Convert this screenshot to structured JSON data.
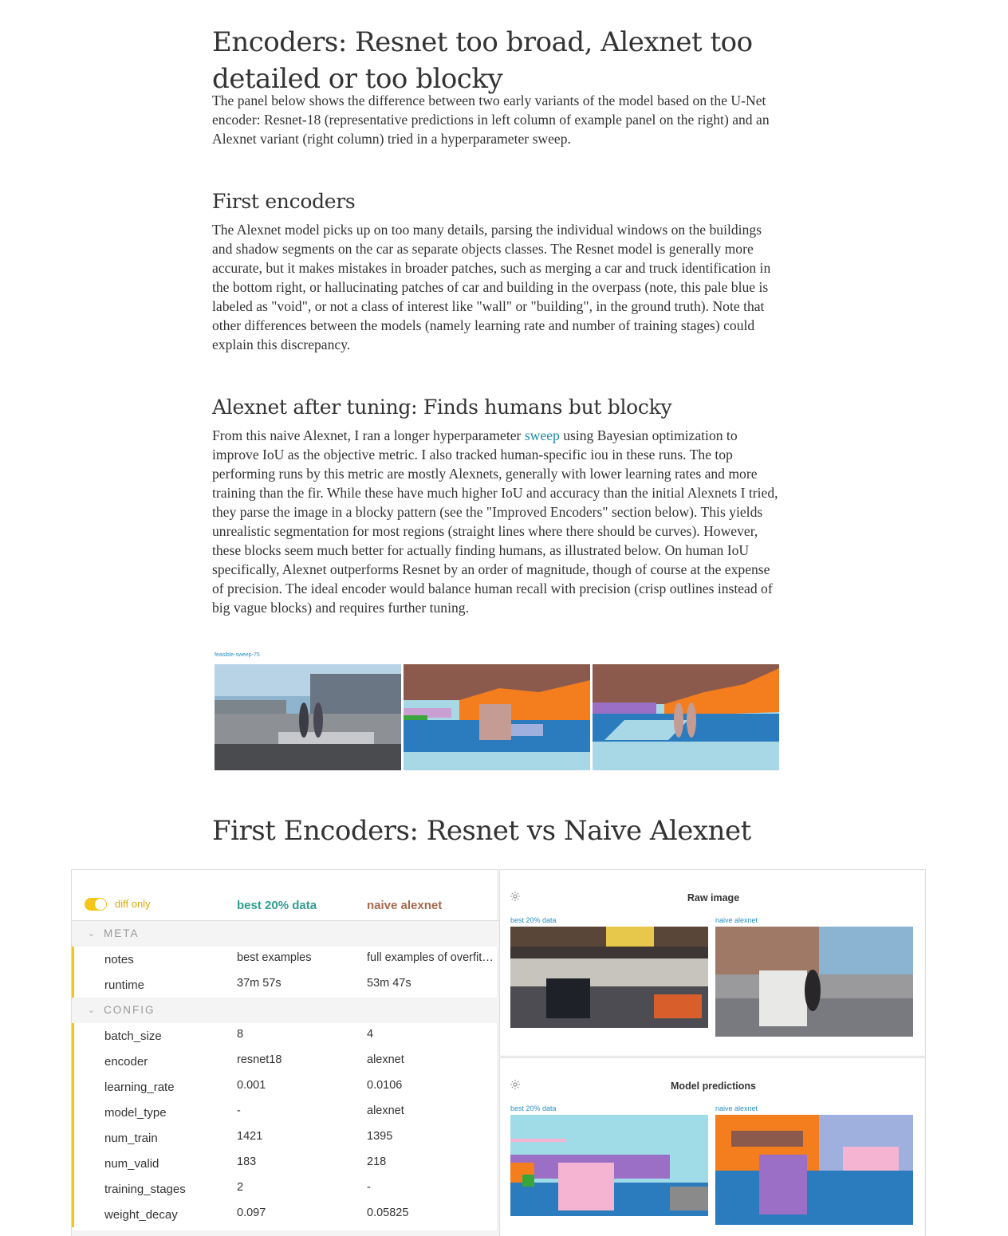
{
  "article": {
    "h1_encoders": "Encoders: Resnet too broad, Alexnet too detailed or too blocky",
    "p1": "The panel below shows the difference between two early variants of the model based on the U-Net encoder: Resnet-18 (representative predictions in left column of example panel on the right) and an Alexnet variant (right column) tried in a hyperparameter sweep.",
    "h2_first": "First encoders",
    "p2": "The Alexnet model picks up on too many details, parsing the individual windows on the buildings and shadow segments on the car as separate objects classes. The Resnet model is generally more accurate, but it makes mistakes in broader patches, such as merging a car and truck identification in the bottom right, or hallucinating patches of car and building in the overpass (note, this pale blue is labeled as \"void\", or not a class of interest like \"wall\" or \"building\", in the ground truth). Note that other differences between the models (namely learning rate and number of training stages) could explain this discrepancy.",
    "h2_tuning": "Alexnet after tuning: Finds humans but blocky",
    "p3_before": "From this naive Alexnet, I ran a longer hyperparameter ",
    "p3_link": "sweep",
    "p3_after": " using Bayesian optimization to improve IoU as the objective metric. I also tracked human-specific iou in these runs. The top performing runs by this metric are mostly Alexnets, generally with lower learning rates and more training than the fir. While these have much higher IoU and accuracy than the initial Alexnets I tried, they parse the image in a blocky pattern (see the \"Improved Encoders\" section below). This yields unrealistic segmentation for most regions (straight lines where there should be curves). However, these blocks seem much better for actually finding humans, as illustrated below. On human IoU specifically, Alexnet outperforms Resnet by an order of magnitude, though of course at the expense of precision. The ideal encoder would balance human recall with precision (crisp outlines instead of big vague blocks) and requires further tuning.",
    "strip_label": "feasible-sweep-75",
    "h1_first_vs": "First Encoders: Resnet vs Naive Alexnet"
  },
  "panel": {
    "diff_only": "diff only",
    "col_a": "best 20% data",
    "col_b": "naive alexnet",
    "sections": [
      {
        "label": "META",
        "rows": [
          {
            "key": "notes",
            "a": "best examples",
            "b": "full examples of overfitting"
          },
          {
            "key": "runtime",
            "a": "37m 57s",
            "b": "53m 47s"
          }
        ]
      },
      {
        "label": "CONFIG",
        "rows": [
          {
            "key": "batch_size",
            "a": "8",
            "b": "4"
          },
          {
            "key": "encoder",
            "a": "resnet18",
            "b": "alexnet"
          },
          {
            "key": "learning_rate",
            "a": "0.001",
            "b": "0.0106"
          },
          {
            "key": "model_type",
            "a": "-",
            "b": "alexnet"
          },
          {
            "key": "num_train",
            "a": "1421",
            "b": "1395"
          },
          {
            "key": "num_valid",
            "a": "183",
            "b": "218"
          },
          {
            "key": "training_stages",
            "a": "2",
            "b": "-"
          },
          {
            "key": "weight_decay",
            "a": "0.097",
            "b": "0.05825"
          }
        ]
      }
    ],
    "raw_title": "Raw image",
    "pred_title": "Model predictions",
    "label_a": "best 20% data",
    "label_b": "naive alexnet"
  },
  "colors": {
    "accent_yellow": "#f5c518",
    "col_a_teal": "#2f9e8f",
    "col_b_brown": "#a66a4f",
    "link_blue": "#1b8aa6"
  }
}
